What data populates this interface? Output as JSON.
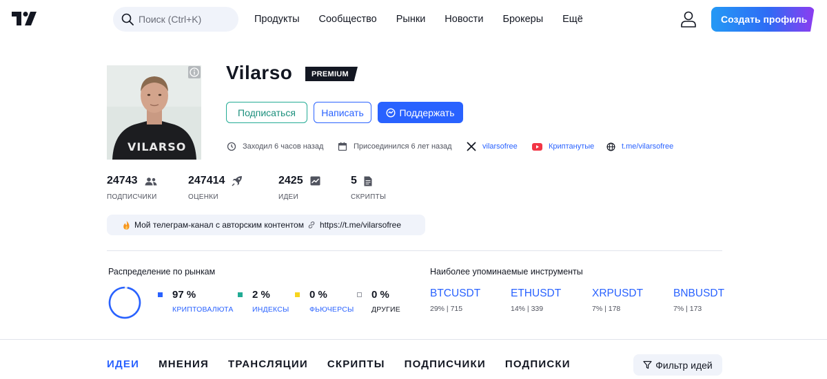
{
  "header": {
    "search_placeholder": "Поиск (Ctrl+K)",
    "nav": [
      "Продукты",
      "Сообщество",
      "Рынки",
      "Новости",
      "Брокеры",
      "Ещё"
    ],
    "cta_label": "Создать профиль"
  },
  "profile": {
    "username": "Vilarso",
    "badge": "PREMIUM",
    "avatar_shirt_text": "VILARSO",
    "buttons": {
      "subscribe": "Подписаться",
      "message": "Написать",
      "support": "Поддержать"
    },
    "meta": {
      "last_seen": "Заходил 6 часов назад",
      "joined": "Присоединился 6 лет назад",
      "x_handle": "vilarsofree",
      "youtube": "Криптанутые",
      "website": "t.me/vilarsofree"
    },
    "stats": [
      {
        "value": "24743",
        "label": "ПОДПИСЧИКИ",
        "icon": "people-icon"
      },
      {
        "value": "247414",
        "label": "ОЦЕНКИ",
        "icon": "rocket-icon"
      },
      {
        "value": "2425",
        "label": "ИДЕИ",
        "icon": "chart-icon"
      },
      {
        "value": "5",
        "label": "СКРИПТЫ",
        "icon": "document-icon"
      }
    ],
    "promo": {
      "text": "Мой телеграм-канал с авторским контентом",
      "link": "https://t.me/vilarsofree"
    }
  },
  "markets": {
    "title": "Распределение по рынкам",
    "items": [
      {
        "percent": "97 %",
        "label": "КРИПТОВАЛЮТА",
        "color": "#2962ff",
        "value": 97
      },
      {
        "percent": "2 %",
        "label": "ИНДЕКСЫ",
        "color": "#22ab94",
        "value": 2
      },
      {
        "percent": "0 %",
        "label": "ФЬЮЧЕРСЫ",
        "color": "#f7d51e",
        "value": 0
      },
      {
        "percent": "0 %",
        "label": "ДРУГИЕ",
        "color": "#ffffff",
        "value": 0
      }
    ]
  },
  "instruments": {
    "title": "Наиболее упоминаемые инструменты",
    "items": [
      {
        "symbol": "BTCUSDT",
        "stats": "29% | 715"
      },
      {
        "symbol": "ETHUSDT",
        "stats": "14% | 339"
      },
      {
        "symbol": "XRPUSDT",
        "stats": "7% | 178"
      },
      {
        "symbol": "BNBUSDT",
        "stats": "7% | 173"
      }
    ]
  },
  "tabs": [
    "ИДЕИ",
    "МНЕНИЯ",
    "ТРАНСЛЯЦИИ",
    "СКРИПТЫ",
    "ПОДПИСЧИКИ",
    "ПОДПИСКИ"
  ],
  "active_tab": "ИДЕИ",
  "filter_label": "Фильтр идей"
}
